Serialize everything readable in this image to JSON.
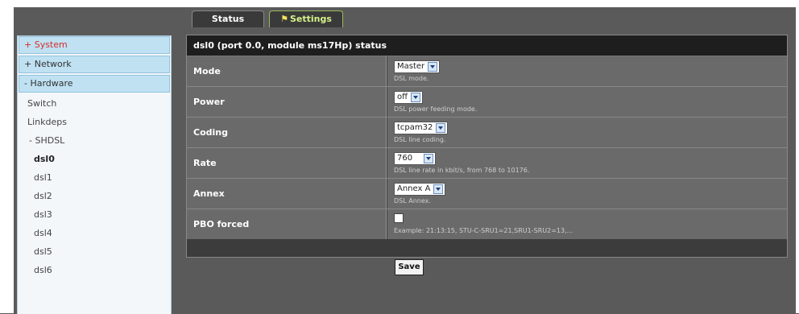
{
  "tabs": {
    "status": "Status",
    "settings": "Settings",
    "settings_icon": "key-icon"
  },
  "sidebar": {
    "system": "+ System",
    "network": "+ Network",
    "hardware": "- Hardware",
    "switch": "Switch",
    "linkdeps": "Linkdeps",
    "shdsl": "- SHDSL",
    "ports": [
      "dsl0",
      "dsl1",
      "dsl2",
      "dsl3",
      "dsl4",
      "dsl5",
      "dsl6"
    ]
  },
  "panel": {
    "title": "dsl0 (port 0.0, module ms17Hp) status",
    "rows": [
      {
        "label": "Mode",
        "value": "Master",
        "hint": "DSL mode."
      },
      {
        "label": "Power",
        "value": "off",
        "hint": "DSL power feeding mode."
      },
      {
        "label": "Coding",
        "value": "tcpam32",
        "hint": "DSL line coding."
      },
      {
        "label": "Rate",
        "value": "760",
        "hint": "DSL line rate in kbit/s, from 768 to 10176."
      },
      {
        "label": "Annex",
        "value": "Annex A",
        "hint": "DSL Annex."
      },
      {
        "label": "PBO forced",
        "checked": false,
        "hint": "Example: 21:13:15, STU-C-SRU1=21,SRU1-SRU2=13,..."
      }
    ]
  },
  "save_label": "Save",
  "colors": {
    "background": "#5a5a5a",
    "sidebar_item": "#bfe1f2",
    "active_red": "#d62c2c",
    "settings_tab_text": "#d6f28a"
  }
}
